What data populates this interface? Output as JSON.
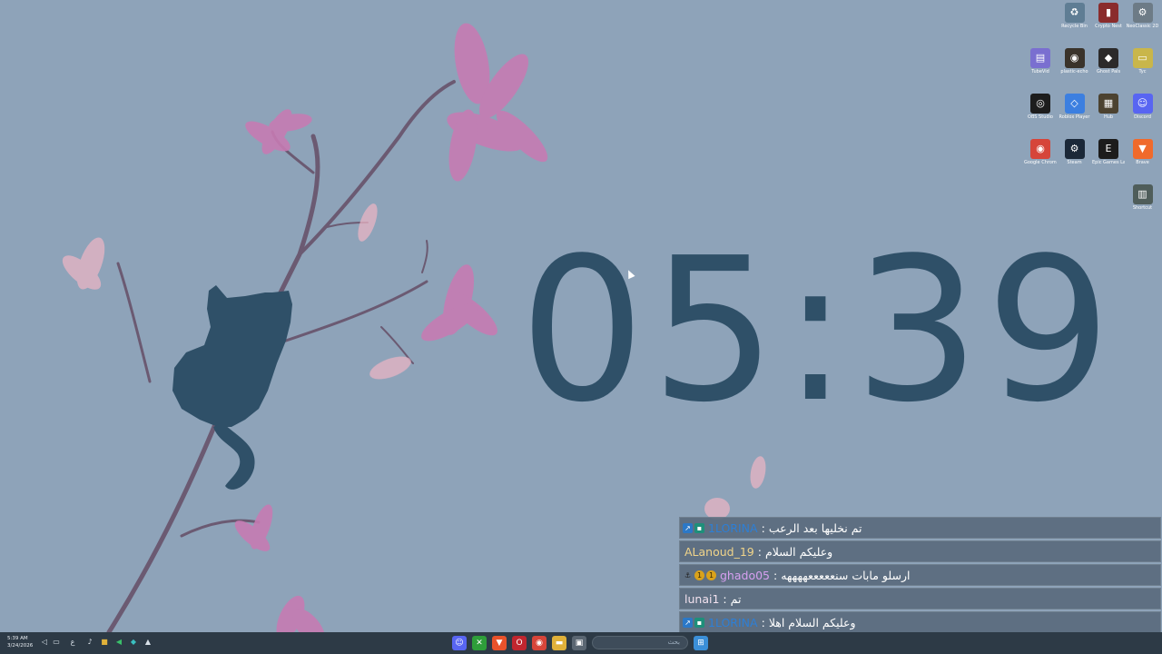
{
  "clock": {
    "time": "05:39"
  },
  "desktop_icons": [
    {
      "label": "Recycle Bin",
      "icon": "recycle-bin-icon",
      "color": "#5f7d94",
      "glyph": "♻"
    },
    {
      "label": "Crypto Nest",
      "icon": "app-icon",
      "color": "#8a2c2c",
      "glyph": "▮"
    },
    {
      "label": "NeoClassic 2D",
      "icon": "gear-icon",
      "color": "#6d7b86",
      "glyph": "⚙"
    },
    {
      "label": "TubeVid",
      "icon": "app-icon",
      "color": "#7a6fd0",
      "glyph": "▤"
    },
    {
      "label": "plastic-echo",
      "icon": "game-icon",
      "color": "#3a332b",
      "glyph": "◉"
    },
    {
      "label": "Ghost Pals",
      "icon": "game-icon",
      "color": "#2c2a2a",
      "glyph": "◆"
    },
    {
      "label": "Tyc",
      "icon": "folder-icon",
      "color": "#c9b64a",
      "glyph": "▭"
    },
    {
      "label": "OBS Studio",
      "icon": "obs-icon",
      "color": "#1d1d1d",
      "glyph": "◎"
    },
    {
      "label": "Roblox Player",
      "icon": "roblox-icon",
      "color": "#3c7fe0",
      "glyph": "◇"
    },
    {
      "label": "Hub",
      "icon": "hub-icon",
      "color": "#4c4230",
      "glyph": "▦"
    },
    {
      "label": "Discord",
      "icon": "discord-icon",
      "color": "#5865f2",
      "glyph": "☺"
    },
    {
      "label": "Google Chrome",
      "icon": "chrome-icon",
      "color": "#d6453a",
      "glyph": "◉"
    },
    {
      "label": "Steam",
      "icon": "steam-icon",
      "color": "#1b2838",
      "glyph": "⚙"
    },
    {
      "label": "Epic Games Launcher",
      "icon": "epic-games-icon",
      "color": "#1c1c1c",
      "glyph": "E"
    },
    {
      "label": "Brave",
      "icon": "brave-icon",
      "color": "#f06a2b",
      "glyph": "▼"
    },
    {
      "label": "Shortcut",
      "icon": "shortcut-icon",
      "color": "#4f5d5a",
      "glyph": "▥"
    }
  ],
  "chat": [
    {
      "badges": [
        "blue",
        "teal"
      ],
      "user": "1LORINA",
      "user_color": "#2d7fd6",
      "message": "تم نخليها بعد الرعب"
    },
    {
      "badges": [],
      "user": "ALanoud_19",
      "user_color": "#f0d48a",
      "message": "وعليكم السلام"
    },
    {
      "badges": [
        "dark",
        "gold",
        "gold"
      ],
      "user": "ghado05",
      "user_color": "#d6a0f0",
      "message": "ارسلو مابات سنعععععههههه"
    },
    {
      "badges": [],
      "user": "lunai1",
      "user_color": "#f3e3f0",
      "message": "تم"
    },
    {
      "badges": [
        "blue",
        "teal"
      ],
      "user": "1LORINA",
      "user_color": "#2d7fd6",
      "message": "وعليكم السلام اهلا"
    }
  ],
  "taskbar": {
    "time": "5:39 AM",
    "date": "3/24/2026",
    "lang": "ع",
    "search_placeholder": "بحث",
    "apps": [
      {
        "name": "discord-icon",
        "color": "#5865f2",
        "glyph": "☺"
      },
      {
        "name": "xbox-icon",
        "color": "#2e9e3a",
        "glyph": "✕"
      },
      {
        "name": "brave-icon",
        "color": "#e8522b",
        "glyph": "▼"
      },
      {
        "name": "opera-icon",
        "color": "#c0262f",
        "glyph": "O"
      },
      {
        "name": "chrome-icon",
        "color": "#d6453a",
        "glyph": "◉"
      },
      {
        "name": "file-explorer-icon",
        "color": "#e0b13a",
        "glyph": "▬"
      },
      {
        "name": "task-view-icon",
        "color": "#5a6672",
        "glyph": "▣"
      }
    ]
  }
}
